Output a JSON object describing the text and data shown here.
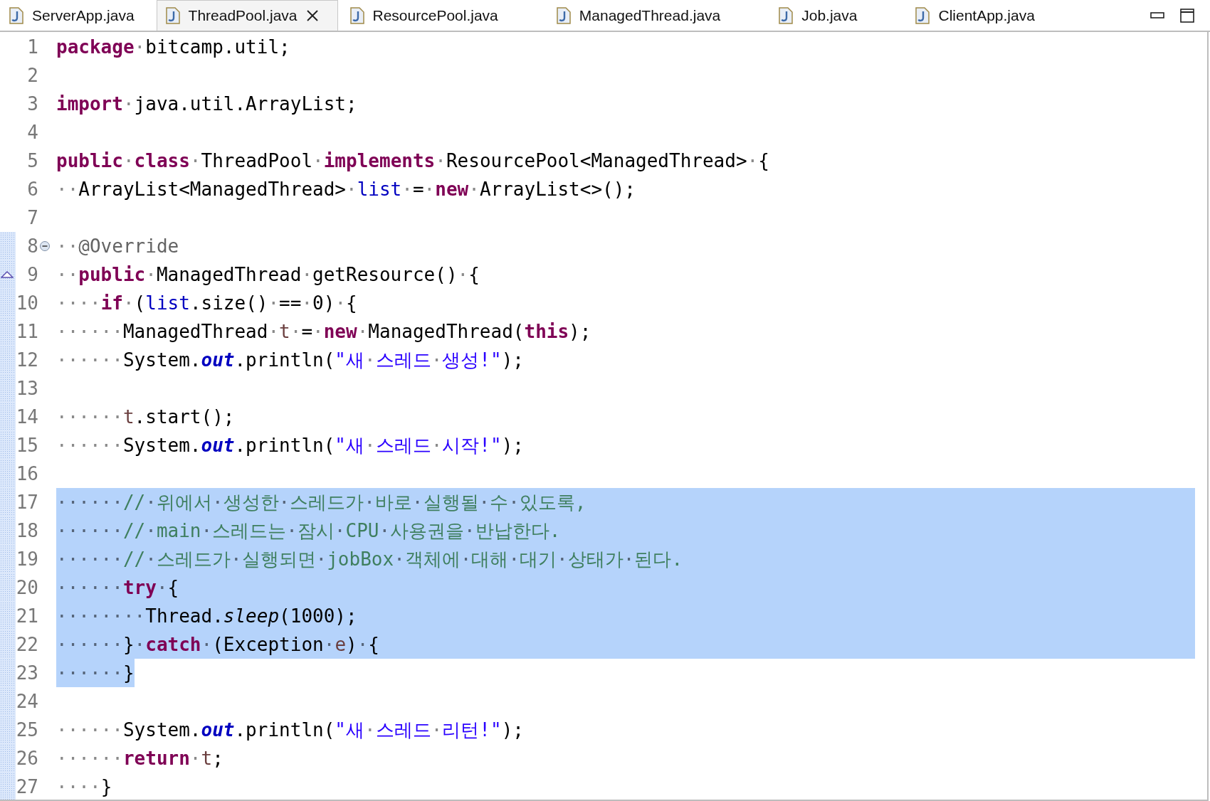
{
  "tabs": [
    {
      "label": "ServerApp.java",
      "selected": false
    },
    {
      "label": "ThreadPool.java",
      "selected": true
    },
    {
      "label": "ResourcePool.java",
      "selected": false
    },
    {
      "label": "ManagedThread.java",
      "selected": false
    },
    {
      "label": "Job.java",
      "selected": false
    },
    {
      "label": "ClientApp.java",
      "selected": false
    }
  ],
  "lines": [
    {
      "number": "1",
      "in_range": false,
      "selected": false,
      "tokens": [
        {
          "kind": "keyword",
          "text": "package"
        },
        {
          "kind": "plain",
          "text": "·bitcamp.util;"
        }
      ]
    },
    {
      "number": "2",
      "in_range": false,
      "selected": false
    },
    {
      "number": "3",
      "in_range": false,
      "selected": false,
      "tokens": [
        {
          "kind": "keyword",
          "text": "import"
        },
        {
          "kind": "plain",
          "text": "·java.util.ArrayList;"
        }
      ]
    },
    {
      "number": "4",
      "in_range": false,
      "selected": false
    },
    {
      "number": "5",
      "in_range": false,
      "selected": false,
      "tokens": [
        {
          "kind": "keyword",
          "text": "public"
        },
        {
          "kind": "plain",
          "text": "·"
        },
        {
          "kind": "keyword",
          "text": "class"
        },
        {
          "kind": "plain",
          "text": "·ThreadPool·"
        },
        {
          "kind": "keyword",
          "text": "implements"
        },
        {
          "kind": "plain",
          "text": "·ResourcePool<ManagedThread>·{"
        }
      ]
    },
    {
      "number": "6",
      "in_range": false,
      "selected": false,
      "tokens": [
        {
          "kind": "plain",
          "text": "··ArrayList<ManagedThread>·"
        },
        {
          "kind": "field",
          "text": "list"
        },
        {
          "kind": "plain",
          "text": "·=·"
        },
        {
          "kind": "keyword",
          "text": "new"
        },
        {
          "kind": "plain",
          "text": "·ArrayList<>();"
        }
      ]
    },
    {
      "number": "7",
      "in_range": false,
      "selected": false
    },
    {
      "number": "8",
      "in_range": true,
      "selected": false,
      "collapsible": true,
      "tokens": [
        {
          "kind": "plain",
          "text": "··"
        },
        {
          "kind": "annotation",
          "text": "@Override"
        }
      ]
    },
    {
      "number": "9",
      "in_range": true,
      "selected": false,
      "overrides": true,
      "tokens": [
        {
          "kind": "plain",
          "text": "··"
        },
        {
          "kind": "keyword",
          "text": "public"
        },
        {
          "kind": "plain",
          "text": "·ManagedThread·getResource()·{"
        }
      ]
    },
    {
      "number": "10",
      "in_range": true,
      "selected": false,
      "tokens": [
        {
          "kind": "plain",
          "text": "····"
        },
        {
          "kind": "keyword",
          "text": "if"
        },
        {
          "kind": "plain",
          "text": "·("
        },
        {
          "kind": "field",
          "text": "list"
        },
        {
          "kind": "plain",
          "text": ".size()·==·0)·{"
        }
      ]
    },
    {
      "number": "11",
      "in_range": true,
      "selected": false,
      "tokens": [
        {
          "kind": "plain",
          "text": "······ManagedThread·"
        },
        {
          "kind": "local",
          "text": "t"
        },
        {
          "kind": "plain",
          "text": "·=·"
        },
        {
          "kind": "keyword",
          "text": "new"
        },
        {
          "kind": "plain",
          "text": "·ManagedThread("
        },
        {
          "kind": "keyword",
          "text": "this"
        },
        {
          "kind": "plain",
          "text": ");"
        }
      ]
    },
    {
      "number": "12",
      "in_range": true,
      "selected": false,
      "tokens": [
        {
          "kind": "plain",
          "text": "······System."
        },
        {
          "kind": "static_field",
          "text": "out"
        },
        {
          "kind": "plain",
          "text": ".println("
        },
        {
          "kind": "string",
          "text": "\"새·스레드·생성!\""
        },
        {
          "kind": "plain",
          "text": ");"
        }
      ]
    },
    {
      "number": "13",
      "in_range": true,
      "selected": false
    },
    {
      "number": "14",
      "in_range": true,
      "selected": false,
      "tokens": [
        {
          "kind": "plain",
          "text": "······"
        },
        {
          "kind": "local",
          "text": "t"
        },
        {
          "kind": "plain",
          "text": ".start();"
        }
      ]
    },
    {
      "number": "15",
      "in_range": true,
      "selected": false,
      "tokens": [
        {
          "kind": "plain",
          "text": "······System."
        },
        {
          "kind": "static_field",
          "text": "out"
        },
        {
          "kind": "plain",
          "text": ".println("
        },
        {
          "kind": "string",
          "text": "\"새·스레드·시작!\""
        },
        {
          "kind": "plain",
          "text": ");"
        }
      ]
    },
    {
      "number": "16",
      "in_range": true,
      "selected": false
    },
    {
      "number": "17",
      "in_range": true,
      "selected": true,
      "tokens": [
        {
          "kind": "plain",
          "text": "······"
        },
        {
          "kind": "comment",
          "text": "//·위에서·생성한·스레드가·바로·실행될·수·있도록,"
        }
      ]
    },
    {
      "number": "18",
      "in_range": true,
      "selected": true,
      "tokens": [
        {
          "kind": "plain",
          "text": "······"
        },
        {
          "kind": "comment",
          "text": "//·main·스레드는·잠시·CPU·사용권을·반납한다."
        }
      ]
    },
    {
      "number": "19",
      "in_range": true,
      "selected": true,
      "tokens": [
        {
          "kind": "plain",
          "text": "······"
        },
        {
          "kind": "comment",
          "text": "//·스레드가·실행되면·jobBox·객체에·대해·대기·상태가·된다."
        }
      ]
    },
    {
      "number": "20",
      "in_range": true,
      "selected": true,
      "tokens": [
        {
          "kind": "plain",
          "text": "······"
        },
        {
          "kind": "keyword",
          "text": "try"
        },
        {
          "kind": "plain",
          "text": "·{"
        }
      ]
    },
    {
      "number": "21",
      "in_range": true,
      "selected": true,
      "tokens": [
        {
          "kind": "plain",
          "text": "········Thread."
        },
        {
          "kind": "static_method",
          "text": "sleep"
        },
        {
          "kind": "plain",
          "text": "(1000);"
        }
      ]
    },
    {
      "number": "22",
      "in_range": true,
      "selected": true,
      "tokens": [
        {
          "kind": "plain",
          "text": "······}·"
        },
        {
          "kind": "keyword",
          "text": "catch"
        },
        {
          "kind": "plain",
          "text": "·(Exception·"
        },
        {
          "kind": "local",
          "text": "e"
        },
        {
          "kind": "plain",
          "text": ")·{"
        }
      ]
    },
    {
      "number": "23",
      "in_range": true,
      "selected": true,
      "partial_selection": true,
      "tokens": [
        {
          "kind": "plain",
          "text": "······}"
        }
      ]
    },
    {
      "number": "24",
      "in_range": true,
      "selected": false
    },
    {
      "number": "25",
      "in_range": true,
      "selected": false,
      "tokens": [
        {
          "kind": "plain",
          "text": "······System."
        },
        {
          "kind": "static_field",
          "text": "out"
        },
        {
          "kind": "plain",
          "text": ".println("
        },
        {
          "kind": "string",
          "text": "\"새·스레드·리턴!\""
        },
        {
          "kind": "plain",
          "text": ");"
        }
      ]
    },
    {
      "number": "26",
      "in_range": true,
      "selected": false,
      "tokens": [
        {
          "kind": "plain",
          "text": "······"
        },
        {
          "kind": "keyword",
          "text": "return"
        },
        {
          "kind": "plain",
          "text": "·"
        },
        {
          "kind": "local",
          "text": "t"
        },
        {
          "kind": "plain",
          "text": ";"
        }
      ]
    },
    {
      "number": "27",
      "in_range": true,
      "selected": false,
      "tokens": [
        {
          "kind": "plain",
          "text": "····}"
        }
      ]
    }
  ]
}
